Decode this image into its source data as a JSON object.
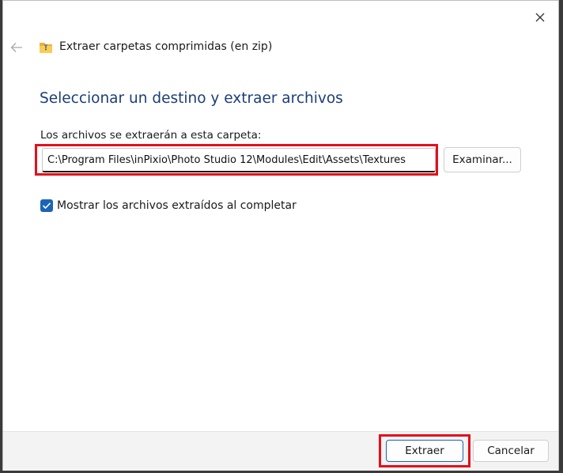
{
  "window": {
    "close_icon": "close-icon",
    "back_icon": "back-arrow-icon",
    "app_icon": "zip-folder-icon",
    "title": "Extraer carpetas comprimidas (en zip)"
  },
  "main": {
    "heading": "Seleccionar un destino y extraer archivos",
    "destination_label": "Los archivos se extraerán a esta carpeta:",
    "destination_value": "C:\\Program Files\\inPixio\\Photo Studio 12\\Modules\\Edit\\Assets\\Textures",
    "browse_label": "Examinar...",
    "show_files_checked": true,
    "show_files_label": "Mostrar los archivos extraídos al completar"
  },
  "footer": {
    "extract_label": "Extraer",
    "cancel_label": "Cancelar"
  },
  "colors": {
    "accent": "#1a64b8",
    "heading": "#1b3e78",
    "highlight": "#e3101b",
    "footer_bg": "#f3f3f3"
  }
}
